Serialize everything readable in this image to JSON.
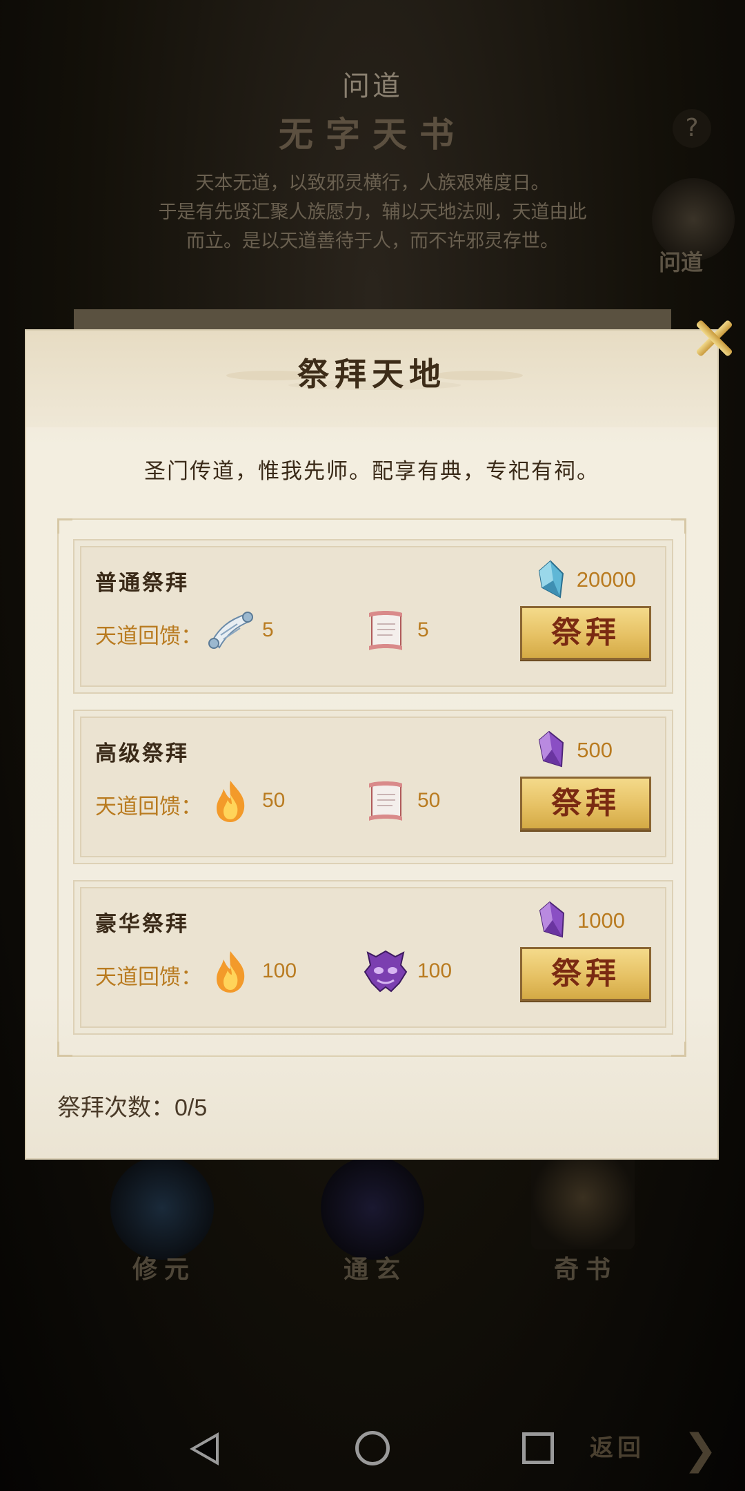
{
  "background": {
    "top_title": "问道",
    "book_title": "无字天书",
    "help_icon_text": "?",
    "description": [
      "天本无道，以致邪灵横行，人族艰难度日。",
      "于是有先贤汇聚人族愿力，辅以天地法则，天道由此",
      "而立。是以天道善待于人，而不许邪灵存世。"
    ],
    "side_button_label": "问道",
    "bottom_items": [
      "修元",
      "通玄",
      "奇书"
    ],
    "return_label": "返回"
  },
  "dialog": {
    "title": "祭拜天地",
    "subtitle": "圣门传道，惟我先师。配享有典，专祀有祠。",
    "rows": [
      {
        "title": "普通祭拜",
        "cost": "20000",
        "cost_currency_icon": "blue-crystal-icon",
        "reward_label": "天道回馈：",
        "rewards": [
          {
            "icon": "blue-scroll-icon",
            "amount": "5"
          },
          {
            "icon": "red-scroll-icon",
            "amount": "5"
          }
        ],
        "button_label": "祭拜"
      },
      {
        "title": "高级祭拜",
        "cost": "500",
        "cost_currency_icon": "purple-crystal-icon",
        "reward_label": "天道回馈：",
        "rewards": [
          {
            "icon": "flame-icon",
            "amount": "50"
          },
          {
            "icon": "red-scroll-icon",
            "amount": "50"
          }
        ],
        "button_label": "祭拜"
      },
      {
        "title": "豪华祭拜",
        "cost": "1000",
        "cost_currency_icon": "purple-crystal-icon",
        "reward_label": "天道回馈：",
        "rewards": [
          {
            "icon": "flame-icon",
            "amount": "100"
          },
          {
            "icon": "purple-demon-mask-icon",
            "amount": "100"
          }
        ],
        "button_label": "祭拜"
      }
    ],
    "count_label": "祭拜次数：0/5"
  },
  "colors": {
    "accent_gold": "#b97b20",
    "button_gold": "#e6c164",
    "button_text": "#7a2a12",
    "panel_bg": "#f2ede0"
  }
}
